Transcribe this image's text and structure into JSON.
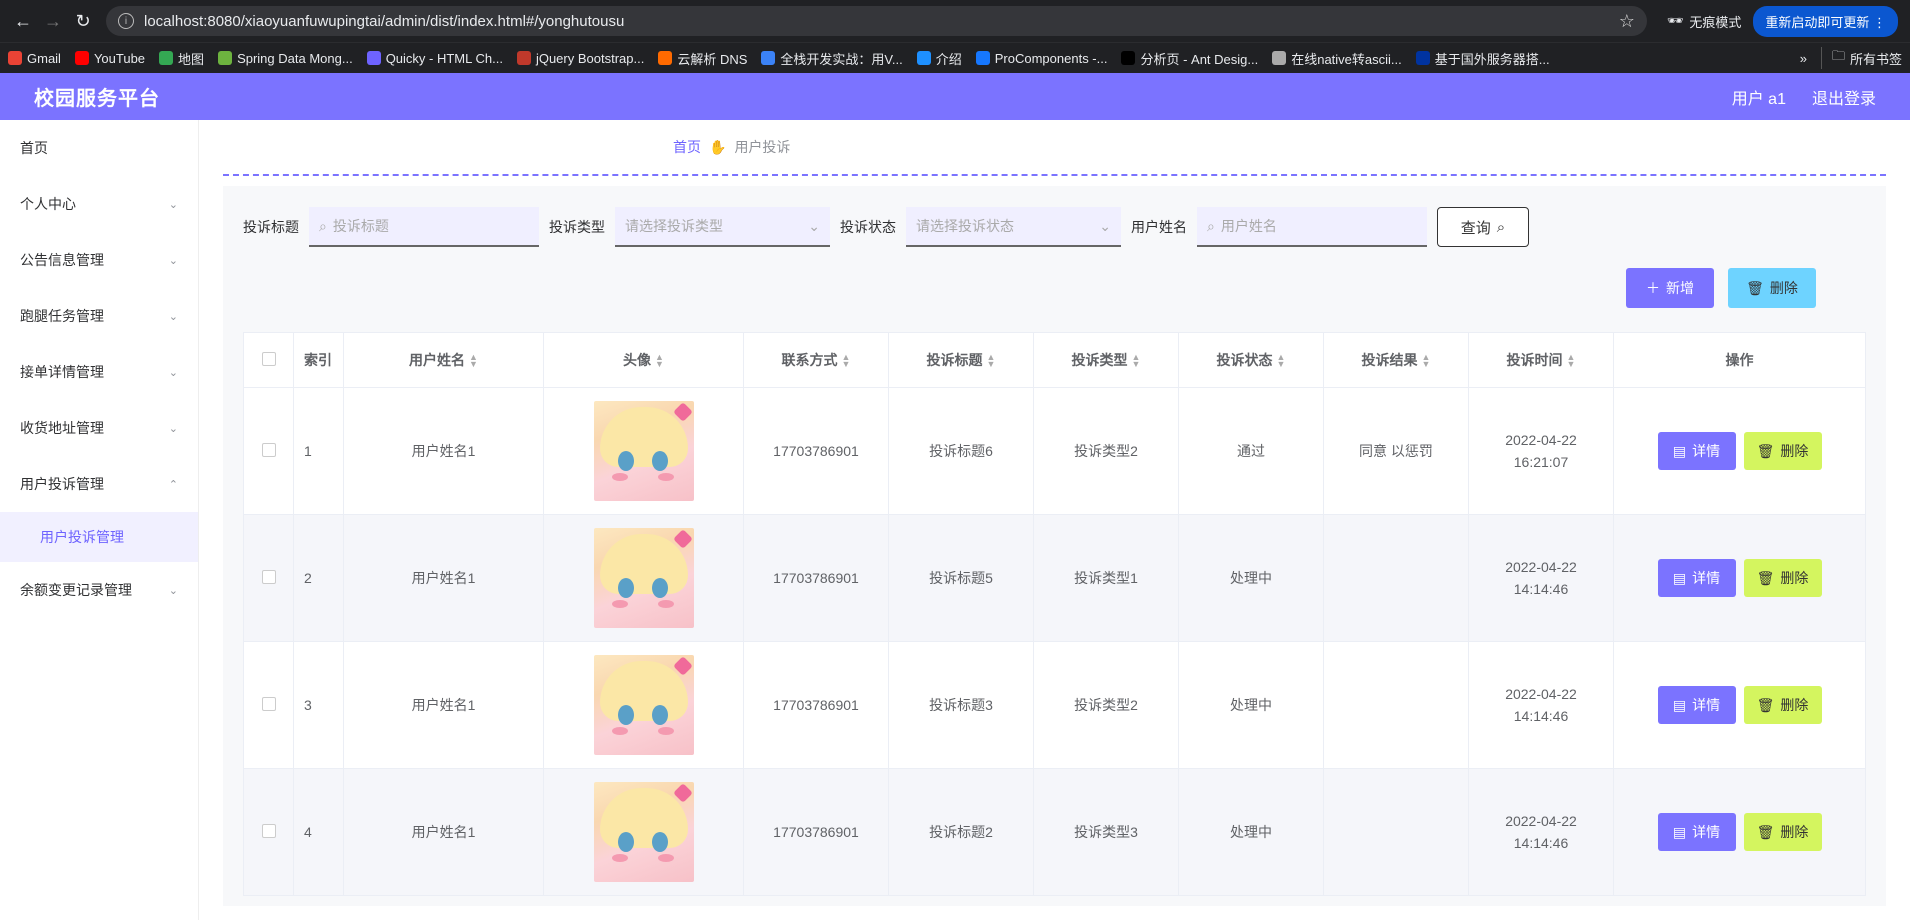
{
  "browser": {
    "url": "localhost:8080/xiaoyuanfuwupingtai/admin/dist/index.html#/yonghutousu",
    "incognito": "无痕模式",
    "update": "重新启动即可更新",
    "bookmarks": [
      {
        "label": "Gmail",
        "color": "#ea4335"
      },
      {
        "label": "YouTube",
        "color": "#ff0000"
      },
      {
        "label": "地图",
        "color": "#34a853"
      },
      {
        "label": "Spring Data Mong...",
        "color": "#6db33f"
      },
      {
        "label": "Quicky - HTML Ch...",
        "color": "#6e63ff"
      },
      {
        "label": "jQuery Bootstrap...",
        "color": "#c0392b"
      },
      {
        "label": "云解析 DNS",
        "color": "#ff6a00"
      },
      {
        "label": "全栈开发实战：用V...",
        "color": "#3b82f6"
      },
      {
        "label": "介绍",
        "color": "#1e90ff"
      },
      {
        "label": "ProComponents -...",
        "color": "#1677ff"
      },
      {
        "label": "分析页 - Ant Desig...",
        "color": "#000000"
      },
      {
        "label": "在线native转ascii...",
        "color": "#aaaaaa"
      },
      {
        "label": "基于国外服务器搭...",
        "color": "#0033a0"
      }
    ],
    "all_bookmarks": "所有书签"
  },
  "header": {
    "title": "校园服务平台",
    "user": "用户 a1",
    "logout": "退出登录"
  },
  "sidebar": {
    "items": [
      {
        "label": "首页",
        "chevron": ""
      },
      {
        "label": "个人中心",
        "chevron": "⌄"
      },
      {
        "label": "公告信息管理",
        "chevron": "⌄"
      },
      {
        "label": "跑腿任务管理",
        "chevron": "⌄"
      },
      {
        "label": "接单详情管理",
        "chevron": "⌄"
      },
      {
        "label": "收货地址管理",
        "chevron": "⌄"
      },
      {
        "label": "用户投诉管理",
        "chevron": "⌃"
      }
    ],
    "sub_item": "用户投诉管理",
    "last_item": "余额变更记录管理"
  },
  "breadcrumb": {
    "home": "首页",
    "current": "用户投诉"
  },
  "search": {
    "title_label": "投诉标题",
    "title_placeholder": "投诉标题",
    "type_label": "投诉类型",
    "type_placeholder": "请选择投诉类型",
    "status_label": "投诉状态",
    "status_placeholder": "请选择投诉状态",
    "name_label": "用户姓名",
    "name_placeholder": "用户姓名",
    "query_button": "查询"
  },
  "actions": {
    "add": "新增",
    "delete": "删除"
  },
  "table": {
    "columns": [
      "索引",
      "用户姓名",
      "头像",
      "联系方式",
      "投诉标题",
      "投诉类型",
      "投诉状态",
      "投诉结果",
      "投诉时间",
      "操作"
    ],
    "detail_button": "详情",
    "delete_button": "删除",
    "rows": [
      {
        "index": "1",
        "name": "用户姓名1",
        "phone": "17703786901",
        "title": "投诉标题6",
        "type": "投诉类型2",
        "status": "通过",
        "result": "同意 以惩罚",
        "time": "2022-04-22 16:21:07"
      },
      {
        "index": "2",
        "name": "用户姓名1",
        "phone": "17703786901",
        "title": "投诉标题5",
        "type": "投诉类型1",
        "status": "处理中",
        "result": "",
        "time": "2022-04-22 14:14:46"
      },
      {
        "index": "3",
        "name": "用户姓名1",
        "phone": "17703786901",
        "title": "投诉标题3",
        "type": "投诉类型2",
        "status": "处理中",
        "result": "",
        "time": "2022-04-22 14:14:46"
      },
      {
        "index": "4",
        "name": "用户姓名1",
        "phone": "17703786901",
        "title": "投诉标题2",
        "type": "投诉类型3",
        "status": "处理中",
        "result": "",
        "time": "2022-04-22 14:14:46"
      }
    ]
  }
}
